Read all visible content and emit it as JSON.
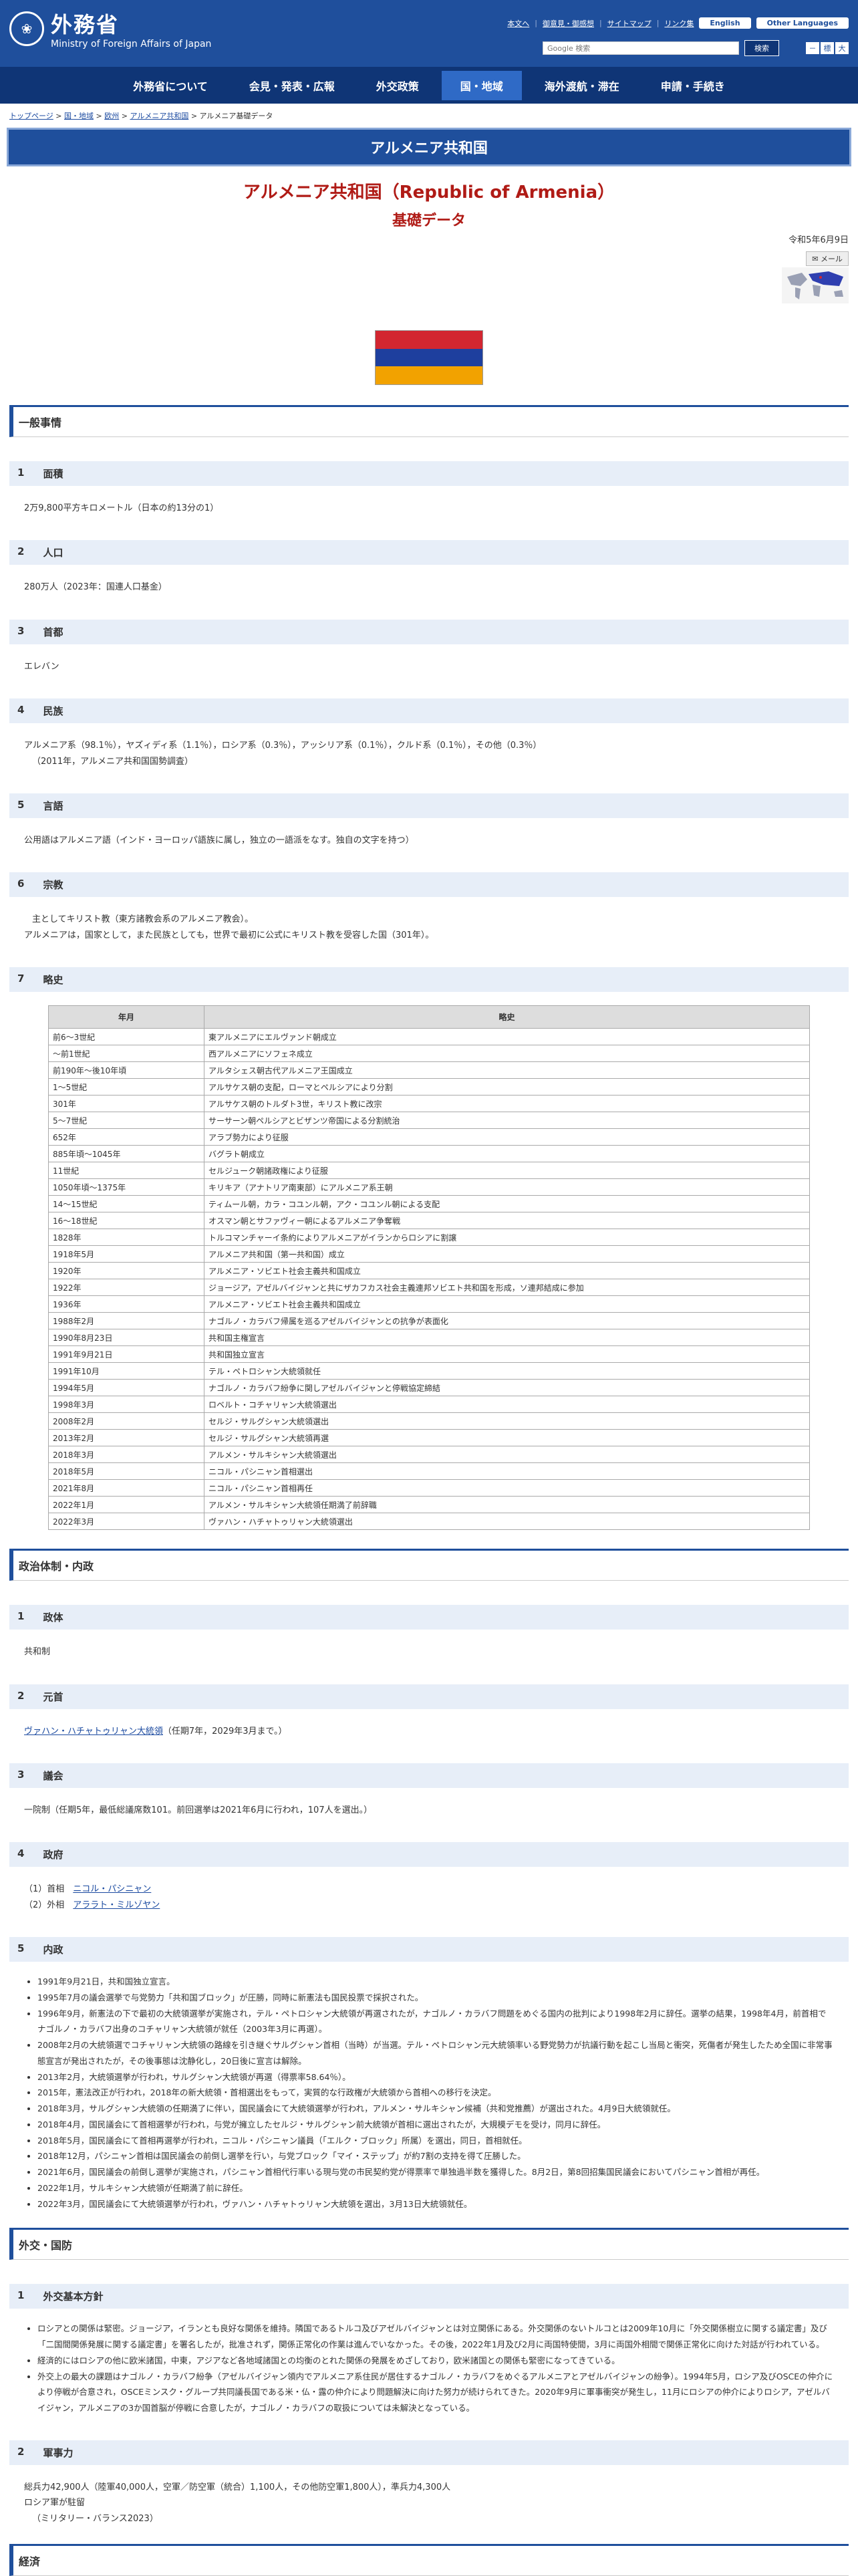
{
  "header": {
    "logo_jp": "外務省",
    "logo_en": "Ministry of Foreign Affairs of Japan",
    "links": [
      "本文へ",
      "御意見・御感想",
      "サイトマップ",
      "リンク集"
    ],
    "english": "English",
    "other_languages": "Other Languages",
    "search_placeholder": "Google 検索",
    "search_button": "検索",
    "font_minus": "－",
    "font_normal": "標",
    "font_plus": "大"
  },
  "nav": [
    "外務省について",
    "会見・発表・広報",
    "外交政策",
    "国・地域",
    "海外渡航・滞在",
    "申請・手続き"
  ],
  "breadcrumbs": {
    "b1": "トップページ",
    "b2": "国・地域",
    "b3": "欧州",
    "b4": "アルメニア共和国",
    "current": "アルメニア基礎データ",
    "sep": " > "
  },
  "title_bar": "アルメニア共和国",
  "doc_title": "アルメニア共和国（Republic of Armenia）",
  "doc_subtitle": "基礎データ",
  "date": "令和5年6月9日",
  "mail_label": "メール",
  "flag_colors": [
    "#d22630",
    "#1e3f9e",
    "#f2a200"
  ],
  "sections": {
    "general": "一般事情",
    "politics": "政治体制・内政",
    "diplomacy": "外交・国防",
    "economy": "経済"
  },
  "general": {
    "s1_num": "1",
    "s1_title": "面積",
    "s1_body": "2万9,800平方キロメートル（日本の約13分の1）",
    "s2_num": "2",
    "s2_title": "人口",
    "s2_body": "280万人（2023年：国連人口基金）",
    "s3_num": "3",
    "s3_title": "首都",
    "s3_body": "エレバン",
    "s4_num": "4",
    "s4_title": "民族",
    "s4_body1": "アルメニア系（98.1％），ヤズィディ系（1.1％），ロシア系（0.3％），アッシリア系（0.1％），クルド系（0.1％），その他（0.3％）",
    "s4_body2": "（2011年，アルメニア共和国国勢調査）",
    "s5_num": "5",
    "s5_title": "言語",
    "s5_body": "公用語はアルメニア語（インド・ヨーロッパ語族に属し，独立の一語派をなす。独自の文字を持つ）",
    "s6_num": "6",
    "s6_title": "宗教",
    "s6_body1": "主としてキリスト教（東方諸教会系のアルメニア教会）。",
    "s6_body2": "アルメニアは，国家として，また民族としても，世界で最初に公式にキリスト教を受容した国（301年）。",
    "s7_num": "7",
    "s7_title": "略史"
  },
  "history": {
    "h_year": "年月",
    "h_event": "略史",
    "rows": [
      [
        "前6～3世紀",
        "東アルメニアにエルヴァンド朝成立"
      ],
      [
        "～前1世紀",
        "西アルメニアにソフェネ成立"
      ],
      [
        "前190年～後10年頃",
        "アルタシェス朝古代アルメニア王国成立"
      ],
      [
        "1～5世紀",
        "アルサケス朝の支配，ローマとペルシアにより分割"
      ],
      [
        "301年",
        "アルサケス朝のトルダト3世，キリスト教に改宗"
      ],
      [
        "5～7世紀",
        "サーサーン朝ペルシアとビザンツ帝国による分割統治"
      ],
      [
        "652年",
        "アラブ勢力により征服"
      ],
      [
        "885年頃～1045年",
        "バグラト朝成立"
      ],
      [
        "11世紀",
        "セルジューク朝諸政権により征服"
      ],
      [
        "1050年頃～1375年",
        "キリキア（アナトリア南東部）にアルメニア系王朝"
      ],
      [
        "14～15世紀",
        "ティムール朝，カラ・コユンル朝，アク・コユンル朝による支配"
      ],
      [
        "16～18世紀",
        "オスマン朝とサファヴィー朝によるアルメニア争奪戦"
      ],
      [
        "1828年",
        "トルコマンチャーイ条約によりアルメニアがイランからロシアに割譲"
      ],
      [
        "1918年5月",
        "アルメニア共和国（第一共和国）成立"
      ],
      [
        "1920年",
        "アルメニア・ソビエト社会主義共和国成立"
      ],
      [
        "1922年",
        "ジョージア，アゼルバイジャンと共にザカフカス社会主義連邦ソビエト共和国を形成，ソ連邦結成に参加"
      ],
      [
        "1936年",
        "アルメニア・ソビエト社会主義共和国成立"
      ],
      [
        "1988年2月",
        "ナゴルノ・カラバフ帰属を巡るアゼルバイジャンとの抗争が表面化"
      ],
      [
        "1990年8月23日",
        "共和国主権宣言"
      ],
      [
        "1991年9月21日",
        "共和国独立宣言"
      ],
      [
        "1991年10月",
        "テル・ペトロシャン大統領就任"
      ],
      [
        "1994年5月",
        "ナゴルノ・カラバフ紛争に関しアゼルバイジャンと停戦協定締結"
      ],
      [
        "1998年3月",
        "ロベルト・コチャリャン大統領選出"
      ],
      [
        "2008年2月",
        "セルジ・サルグシャン大統領選出"
      ],
      [
        "2013年2月",
        "セルジ・サルグシャン大統領再選"
      ],
      [
        "2018年3月",
        "アルメン・サルキシャン大統領選出"
      ],
      [
        "2018年5月",
        "ニコル・パシニャン首相選出"
      ],
      [
        "2021年8月",
        "ニコル・パシニャン首相再任"
      ],
      [
        "2022年1月",
        "アルメン・サルキシャン大統領任期満了前辞職"
      ],
      [
        "2022年3月",
        "ヴァハン・ハチャトゥリャン大統領選出"
      ]
    ]
  },
  "politics": {
    "p1_num": "1",
    "p1_title": "政体",
    "p1_body": "共和制",
    "p2_num": "2",
    "p2_title": "元首",
    "p2_link": "ヴァハン・ハチャトゥリャン大統領",
    "p2_rest": "（任期7年，2029年3月まで。）",
    "p3_num": "3",
    "p3_title": "議会",
    "p3_body": "一院制（任期5年，最低総議席数101。前回選挙は2021年6月に行われ，107人を選出。）",
    "p4_num": "4",
    "p4_title": "政府",
    "gov1_label": "（1）首相",
    "gov1_link": "ニコル・パシニャン",
    "gov2_label": "（2）外相",
    "gov2_link": "アララト・ミルゾヤン",
    "p5_num": "5",
    "p5_title": "内政",
    "domestic": [
      "1991年9月21日，共和国独立宣言。",
      "1995年7月の議会選挙で与党勢力「共和国ブロック」が圧勝，同時に新憲法も国民投票で採択された。",
      "1996年9月，新憲法の下で最初の大統領選挙が実施され，テル・ペトロシャン大統領が再選されたが，ナゴルノ・カラバフ問題をめぐる国内の批判により1998年2月に辞任。選挙の結果，1998年4月，前首相でナゴルノ・カラバフ出身のコチャリャン大統領が就任（2003年3月に再選）。",
      "2008年2月の大統領選でコチャリャン大統領の路線を引き継ぐサルグシャン首相（当時）が当選。テル・ペトロシャン元大統領率いる野党勢力が抗議行動を起こし当局と衝突，死傷者が発生したため全国に非常事態宣言が発出されたが，その後事態は沈静化し，20日後に宣言は解除。",
      "2013年2月，大統領選挙が行われ，サルグシャン大統領が再選（得票率58.64％）。",
      "2015年，憲法改正が行われ，2018年の新大統領・首相選出をもって，実質的な行政権が大統領から首相への移行を決定。",
      "2018年3月，サルグシャン大統領の任期満了に伴い，国民議会にて大統領選挙が行われ，アルメン・サルキシャン候補（共和党推薦）が選出された。4月9日大統領就任。",
      "2018年4月，国民議会にて首相選挙が行われ，与党が擁立したセルジ・サルグシャン前大統領が首相に選出されたが，大規模デモを受け，同月に辞任。",
      "2018年5月，国民議会にて首相再選挙が行われ，ニコル・パシニャン議員（「エルク・ブロック」所属）を選出，同日，首相就任。",
      "2018年12月，パシニャン首相は国民議会の前倒し選挙を行い，与党ブロック「マイ・ステップ」が約7割の支持を得て圧勝した。",
      "2021年6月，国民議会の前倒し選挙が実施され，パシニャン首相代行率いる現与党の市民契約党が得票率で単独過半数を獲得した。8月2日，第8回招集国民議会においてパシニャン首相が再任。",
      "2022年1月，サルキシャン大統領が任期満了前に辞任。",
      "2022年3月，国民議会にて大統領選挙が行われ，ヴァハン・ハチャトゥリャン大統領を選出，3月13日大統領就任。"
    ]
  },
  "diplomacy": {
    "d1_num": "1",
    "d1_title": "外交基本方針",
    "policy": [
      "ロシアとの関係は緊密。ジョージア，イランとも良好な関係を維持。隣国であるトルコ及びアゼルバイジャンとは対立関係にある。外交関係のないトルコとは2009年10月に「外交関係樹立に関する議定書」及び「二国間関係発展に関する議定書」を署名したが，批准されず，関係正常化の作業は進んでいなかった。その後，2022年1月及び2月に両国特使間，3月に両国外相間で関係正常化に向けた対話が行われている。",
      "経済的にはロシアの他に欧米諸国，中東，アジアなど各地域諸国との均衡のとれた関係の発展をめざしており，欧米諸国との関係も緊密になってきている。",
      "外交上の最大の課題はナゴルノ・カラバフ紛争（アゼルバイジャン領内でアルメニア系住民が居住するナゴルノ・カラバフをめぐるアルメニアとアゼルバイジャンの紛争）。1994年5月，ロシア及びOSCEの仲介により停戦が合意され，OSCEミンスク・グループ共同議長国である米・仏・露の仲介により問題解決に向けた努力が続けられてきた。2020年9月に軍事衝突が発生し，11月にロシアの仲介によりロシア，アゼルバイジャン，アルメニアの3か国首脳が停戦に合意したが，ナゴルノ・カラバフの取扱については未解決となっている。"
    ],
    "d2_num": "2",
    "d2_title": "軍事力",
    "mil1": "総兵力42,900人（陸軍40,000人，空軍／防空軍（統合）1,100人，その他防空軍1,800人），準兵力4,300人",
    "mil2": "ロシア軍が駐留",
    "mil3": "（ミリタリー・バランス2023）"
  }
}
